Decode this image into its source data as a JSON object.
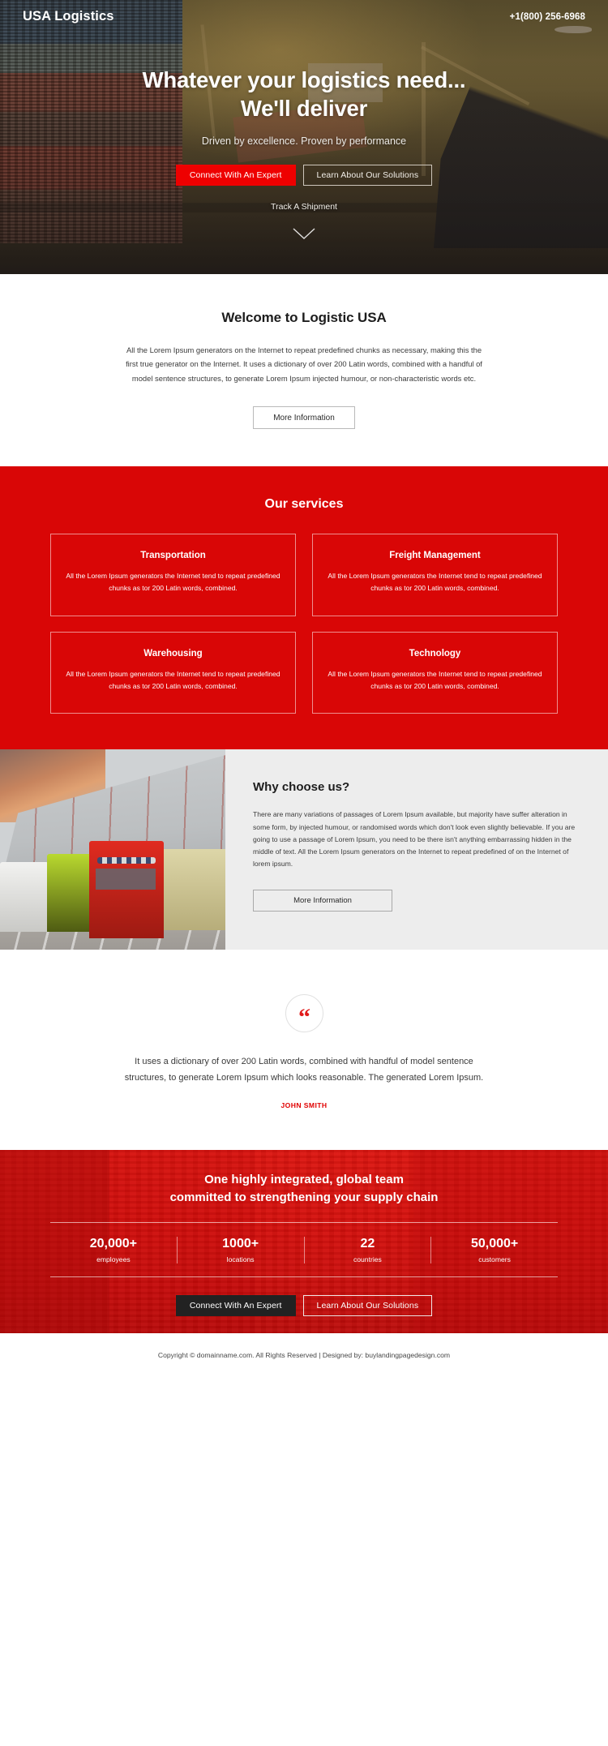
{
  "header": {
    "brand": "USA Logistics",
    "phone": "+1(800) 256-6968"
  },
  "hero": {
    "heading_line1": "Whatever your logistics need...",
    "heading_line2": "We'll deliver",
    "subheading": "Driven by excellence. Proven by performance",
    "primary_cta": "Connect With An Expert",
    "secondary_cta": "Learn About Our Solutions",
    "track_link": "Track A Shipment",
    "scroll_icon": "chevron-down-icon"
  },
  "welcome": {
    "title": "Welcome to Logistic USA",
    "body": "All the Lorem Ipsum generators on the Internet to repeat predefined chunks as necessary, making this the first true generator on the Internet. It uses a dictionary of over 200 Latin words, combined with a handful of model sentence structures, to generate Lorem Ipsum injected humour, or non-characteristic words etc.",
    "cta": "More Information"
  },
  "services": {
    "title": "Our services",
    "cards": [
      {
        "title": "Transportation",
        "body": "All the Lorem Ipsum generators the Internet tend to repeat predefined chunks as tor 200 Latin words, combined."
      },
      {
        "title": "Freight Management",
        "body": "All the Lorem Ipsum generators the Internet tend to repeat predefined chunks as tor 200 Latin words, combined."
      },
      {
        "title": "Warehousing",
        "body": "All the Lorem Ipsum generators the Internet tend to repeat predefined chunks as tor 200 Latin words, combined."
      },
      {
        "title": "Technology",
        "body": "All the Lorem Ipsum generators the Internet tend to repeat predefined chunks as tor 200 Latin words, combined."
      }
    ]
  },
  "why": {
    "title": "Why choose us?",
    "body": "There are many variations of passages of Lorem Ipsum available, but majority have suffer alteration in some form, by injected humour, or randomised words which don't look even slightly believable. If you are going to use a passage of Lorem Ipsum, you need to be there isn't anything embarrassing hidden in the middle of text. All the Lorem Ipsum generators on the Internet to repeat predefined of on the Internet of lorem ipsum.",
    "cta": "More Information",
    "image_alt": "trucks-parked-at-warehouse-photo"
  },
  "testimonial": {
    "icon": "quote-icon",
    "quote": "It uses a dictionary of over 200 Latin words, combined with handful of model sentence structures, to generate Lorem Ipsum which looks reasonable. The generated Lorem Ipsum.",
    "author": "JOHN SMITH"
  },
  "stats_cta": {
    "heading_line1": "One highly integrated, global team",
    "heading_line2": "committed to strengthening your supply chain",
    "stats": [
      {
        "number": "20,000+",
        "label": "employees"
      },
      {
        "number": "1000+",
        "label": "locations"
      },
      {
        "number": "22",
        "label": "countries"
      },
      {
        "number": "50,000+",
        "label": "customers"
      }
    ],
    "primary_cta": "Connect With An Expert",
    "secondary_cta": "Learn About Our Solutions"
  },
  "footer": {
    "copyright": "Copyright © domainname.com. All Rights Reserved  |  Designed by: buylandingpagedesign.com"
  },
  "colors": {
    "brand_red": "#ee0000",
    "services_red": "#d90606",
    "dark_button": "#222222",
    "why_bg": "#ededed"
  }
}
